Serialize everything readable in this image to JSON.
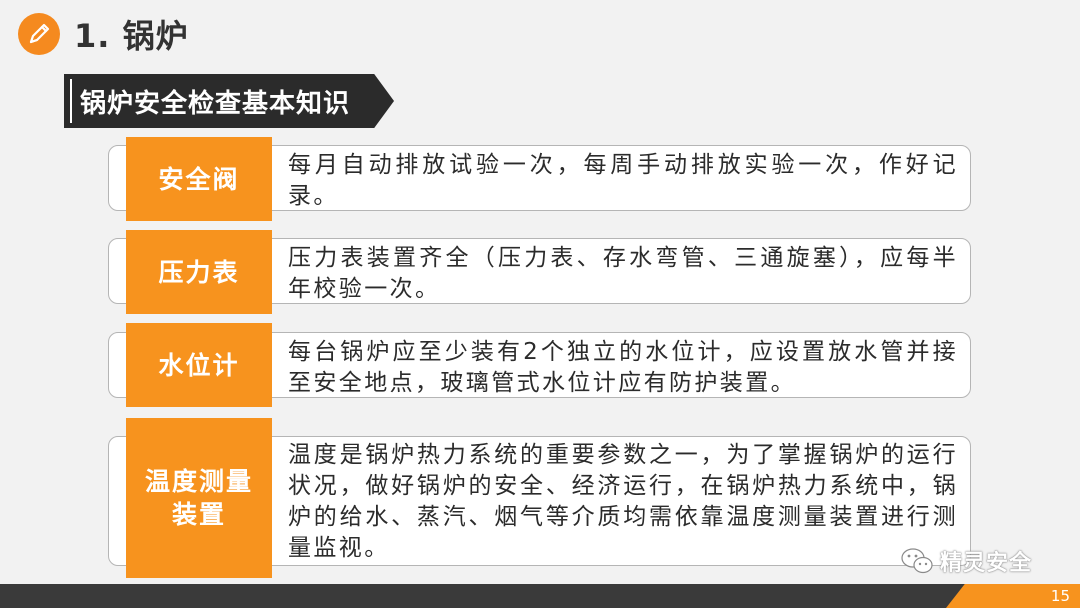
{
  "title": {
    "number_text": "1. 锅炉",
    "icon": "pencil-icon"
  },
  "section_heading": "锅炉安全检查基本知识",
  "items": [
    {
      "label": "安全阀",
      "text": "每月自动排放试验一次，每周手动排放实验一次，作好记录。"
    },
    {
      "label": "压力表",
      "text": "压力表装置齐全（压力表、存水弯管、三通旋塞），应每半年校验一次。"
    },
    {
      "label": "水位计",
      "text": "每台锅炉应至少装有2个独立的水位计，应设置放水管并接至安全地点，玻璃管式水位计应有防护装置。"
    },
    {
      "label": "温度测量装置",
      "text": "温度是锅炉热力系统的重要参数之一，为了掌握锅炉的运行状况，做好锅炉的安全、经济运行，在锅炉热力系统中，锅炉的给水、蒸汽、烟气等介质均需依靠温度测量装置进行测量监视。"
    }
  ],
  "watermark": {
    "icon": "wechat-icon",
    "text": "精灵安全"
  },
  "footer": {
    "page_number": "15"
  },
  "colors": {
    "accent": "#f7931e",
    "dark": "#2b2b2b",
    "background": "#f2f2f2"
  }
}
